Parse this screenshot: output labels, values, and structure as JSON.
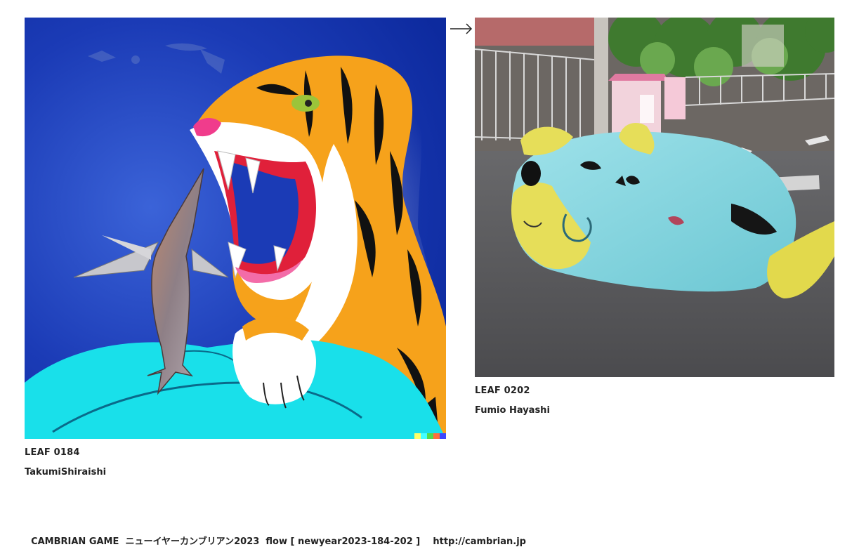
{
  "leaves": [
    {
      "id": "LEAF 0184",
      "author": "TakumiShiraishi",
      "image": "tiger-eating-swordfish-illustration"
    },
    {
      "id": "LEAF 0202",
      "author": "Fumio Hayashi",
      "image": "knitted-blue-fish-plush-on-street-photo"
    }
  ],
  "flow_icon": "right-arrow-icon",
  "footer": {
    "game": "CAMBRIAN GAME",
    "title": "ニューイヤーカンブリアン2023",
    "flow": "flow [ newyear2023-184-202 ]",
    "url": "http://cambrian.jp"
  },
  "colors": {
    "text": "#222222",
    "background": "#ffffff"
  }
}
